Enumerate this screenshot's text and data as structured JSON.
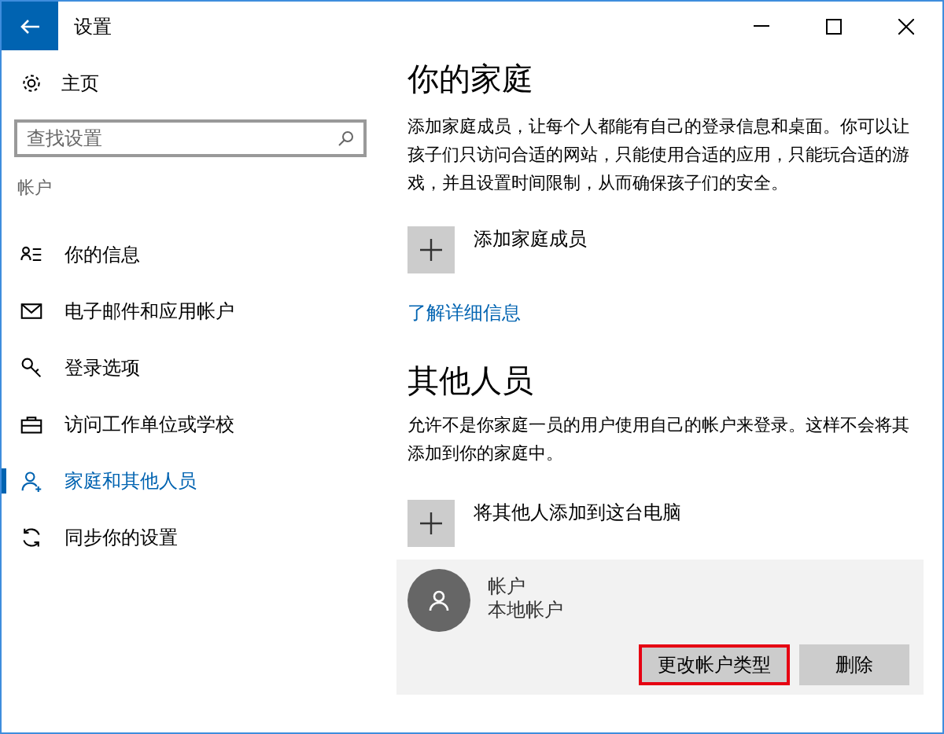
{
  "window": {
    "title": "设置"
  },
  "sidebar": {
    "home": "主页",
    "search": {
      "placeholder": "查找设置"
    },
    "section": "帐户",
    "items": [
      {
        "label": "你的信息",
        "selected": false
      },
      {
        "label": "电子邮件和应用帐户",
        "selected": false
      },
      {
        "label": "登录选项",
        "selected": false
      },
      {
        "label": "访问工作单位或学校",
        "selected": false
      },
      {
        "label": "家庭和其他人员",
        "selected": true
      },
      {
        "label": "同步你的设置",
        "selected": false
      }
    ]
  },
  "family": {
    "heading": "你的家庭",
    "description": "添加家庭成员，让每个人都能有自己的登录信息和桌面。你可以让孩子们只访问合适的网站，只能使用合适的应用，只能玩合适的游戏，并且设置时间限制，从而确保孩子们的安全。",
    "add": "添加家庭成员",
    "link": "了解详细信息"
  },
  "others": {
    "heading": "其他人员",
    "description": "允许不是你家庭一员的用户使用自己的帐户来登录。这样不会将其添加到你的家庭中。",
    "add": "将其他人添加到这台电脑",
    "account": {
      "name": "帐户",
      "type": "本地帐户",
      "buttons": [
        {
          "label": "更改帐户类型",
          "highlighted": true
        },
        {
          "label": "删除",
          "highlighted": false
        }
      ]
    }
  }
}
